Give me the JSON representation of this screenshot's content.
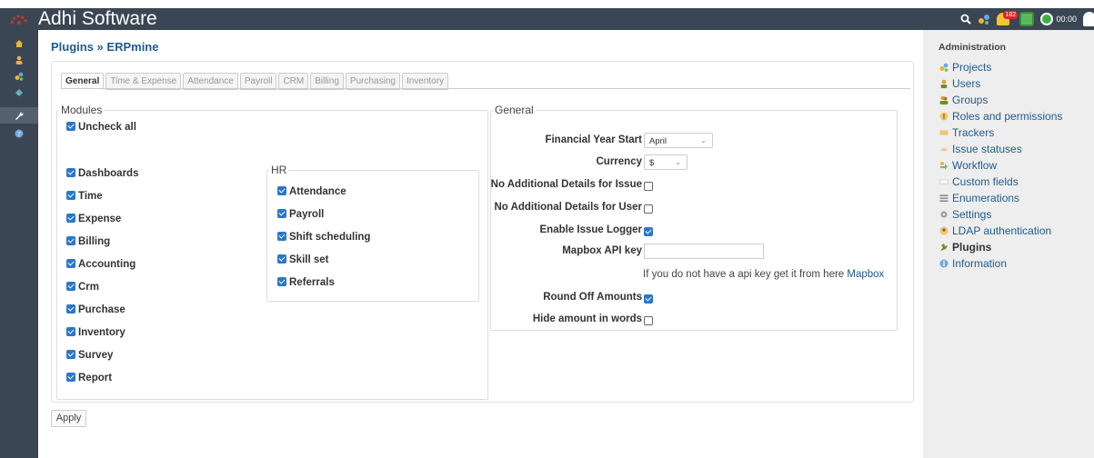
{
  "app": {
    "title": "Adhi Software",
    "notifications_count": "182",
    "timer": "00:00"
  },
  "breadcrumb": "Plugins » ERPmine",
  "tabs": [
    "General",
    "Time & Expense",
    "Attendance",
    "Payroll",
    "CRM",
    "Billing",
    "Purchasing",
    "Inventory"
  ],
  "modules": {
    "legend": "Modules",
    "uncheck_all": "Uncheck all",
    "items": [
      "Dashboards",
      "Time",
      "Expense",
      "Billing",
      "Accounting",
      "Crm",
      "Purchase",
      "Inventory",
      "Survey",
      "Report"
    ]
  },
  "hr": {
    "legend": "HR",
    "items": [
      "Attendance",
      "Payroll",
      "Shift scheduling",
      "Skill set",
      "Referrals"
    ]
  },
  "general": {
    "legend": "General",
    "financial_year_start_label": "Financial Year Start",
    "financial_year_start_value": "April",
    "currency_label": "Currency",
    "currency_value": "$",
    "no_details_issue_label": "No Additional Details for Issue",
    "no_details_user_label": "No Additional Details for User",
    "enable_issue_logger_label": "Enable Issue Logger",
    "mapbox_label": "Mapbox API key",
    "mapbox_value": "",
    "mapbox_hint": "If you do not have a api key get it from here",
    "mapbox_link": "Mapbox",
    "round_off_label": "Round Off Amounts",
    "hide_amount_label": "Hide amount in words"
  },
  "apply_label": "Apply",
  "sidebar": {
    "title": "Administration",
    "items": [
      "Projects",
      "Users",
      "Groups",
      "Roles and permissions",
      "Trackers",
      "Issue statuses",
      "Workflow",
      "Custom fields",
      "Enumerations",
      "Settings",
      "LDAP authentication",
      "Plugins",
      "Information"
    ]
  },
  "colors": {
    "header_bg": "#3b4654",
    "link": "#1f5b8d",
    "checkbox": "#2b77c9",
    "sidebar_bg": "#eeeeee"
  }
}
